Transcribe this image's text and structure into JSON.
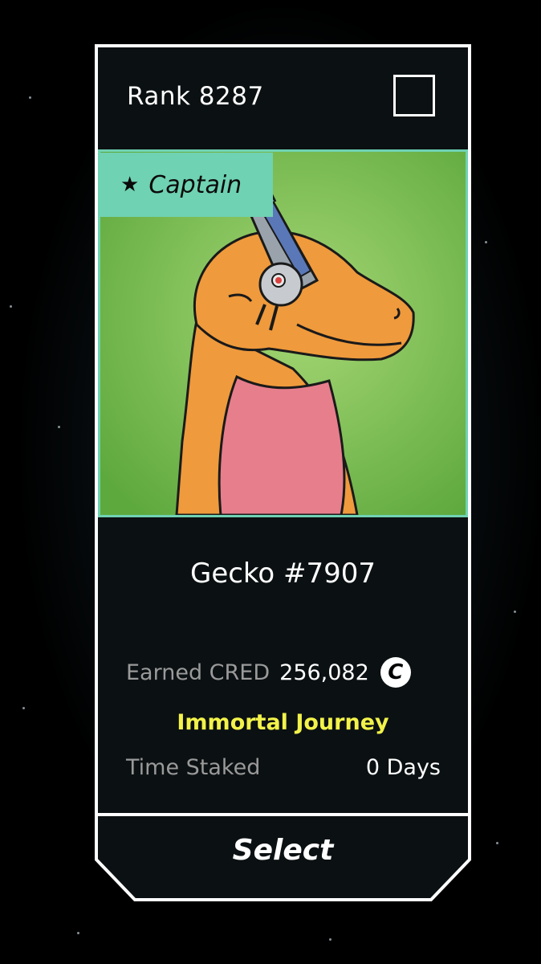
{
  "card": {
    "rank": "Rank 8287",
    "badge": {
      "label": "Captain",
      "icon": "star-icon"
    },
    "name": "Gecko #7907",
    "earned": {
      "label": "Earned CRED",
      "value": "256,082",
      "icon": "cred-coin-icon",
      "icon_letter": "C"
    },
    "journey": "Immortal Journey",
    "time_staked": {
      "label": "Time Staked",
      "value": "0 Days"
    },
    "select_label": "Select",
    "selected": false
  },
  "colors": {
    "background": "#000000",
    "frame": "#ffffff",
    "card_fill": "#0b1012",
    "accent_teal": "#6fd2b2",
    "art_green": "#77b84e",
    "journey_yellow": "#f2f24a",
    "label_gray": "#9a9a9a"
  }
}
